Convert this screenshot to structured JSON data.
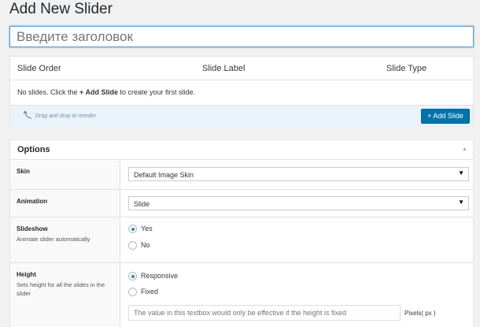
{
  "page": {
    "title": "Add New Slider"
  },
  "title_input": {
    "placeholder": "Введите заголовок"
  },
  "slides": {
    "columns": [
      "Slide Order",
      "Slide Label",
      "Slide Type"
    ],
    "empty_prefix": "No slides. Click the ",
    "empty_action": "+ Add Slide",
    "empty_suffix": " to create your first slide.",
    "drag_hint": "Drag and drop to reorder",
    "add_button": "+ Add Slide"
  },
  "options": {
    "title": "Options",
    "skin": {
      "label": "Skin",
      "value": "Default Image Skin"
    },
    "animation": {
      "label": "Animation",
      "value": "Slide"
    },
    "slideshow": {
      "label": "Slideshow",
      "description": "Animate slider automatically",
      "options": [
        "Yes",
        "No"
      ],
      "selected": "Yes"
    },
    "height": {
      "label": "Height",
      "description": "Sets height for all the slides in the slider",
      "options": [
        "Responsive",
        "Fixed"
      ],
      "selected": "Responsive",
      "input_placeholder": "The value in this textbox would only be effective if the height is fixed",
      "unit_label": "Pixels( px )"
    }
  },
  "colors": {
    "accent": "#0073aa",
    "focus": "#5b9dd9",
    "background": "#f1f1f1"
  }
}
